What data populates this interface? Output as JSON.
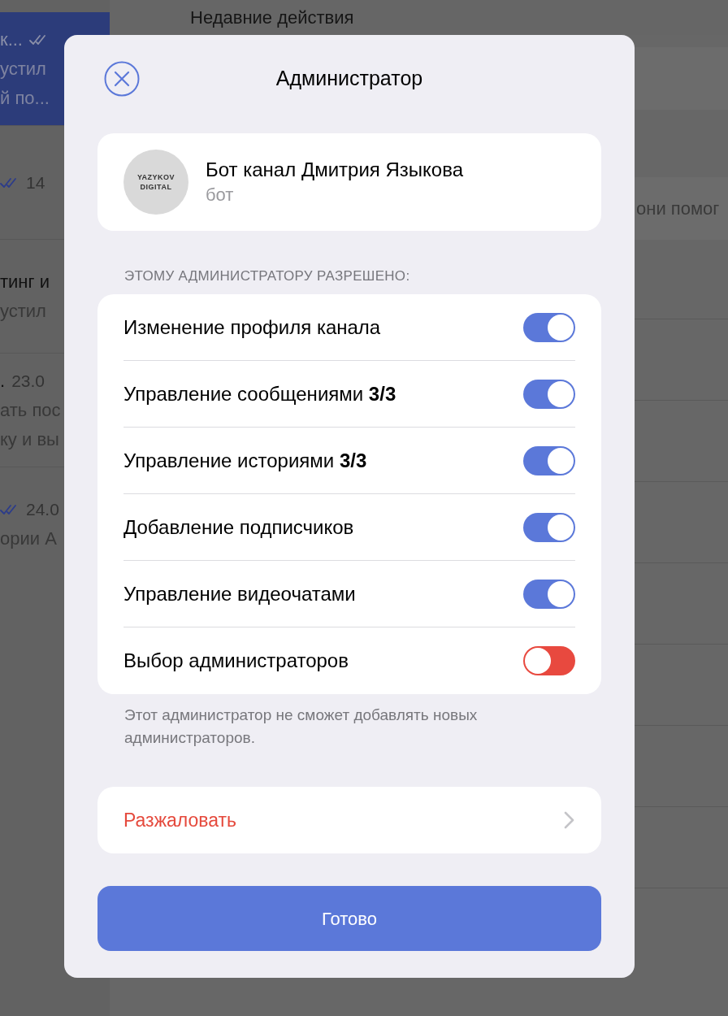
{
  "background": {
    "chat_list": [
      {
        "selected": true,
        "title": "к...",
        "read": true,
        "preview": [
          "устил",
          "й по..."
        ]
      },
      {
        "selected": false,
        "time": "14",
        "read": true
      },
      {
        "selected": false,
        "title": "тинг и",
        "read": false,
        "preview": [
          "устил"
        ]
      },
      {
        "selected": false,
        "title": ".",
        "time": "23.0",
        "read": false,
        "preview": [
          "ать пос",
          "ку и вы"
        ]
      },
      {
        "selected": false,
        "time": "24.0",
        "read": true,
        "preview": [
          "ории А"
        ]
      }
    ],
    "panel": {
      "header": "Недавние действия",
      "snippet": "они помог"
    }
  },
  "dialog": {
    "title": "Администратор",
    "member": {
      "avatar_text": [
        "YAZYKOV",
        "DIGITAL"
      ],
      "name": "Бот канал Дмитрия Языкова",
      "role": "бот"
    },
    "section_header": "ЭТОМУ АДМИНИСТРАТОРУ РАЗРЕШЕНО:",
    "permissions": [
      {
        "label": "Изменение профиля канала",
        "on": true
      },
      {
        "label": "Управление сообщениями **3/3**",
        "on": true
      },
      {
        "label": "Управление историями **3/3**",
        "on": true
      },
      {
        "label": "Добавление подписчиков",
        "on": true
      },
      {
        "label": "Управление видеочатами",
        "on": true
      },
      {
        "label": "Выбор администраторов",
        "on": false
      }
    ],
    "note": "Этот администратор не сможет добавлять новых администраторов.",
    "dismiss": "Разжаловать",
    "done": "Готово"
  }
}
